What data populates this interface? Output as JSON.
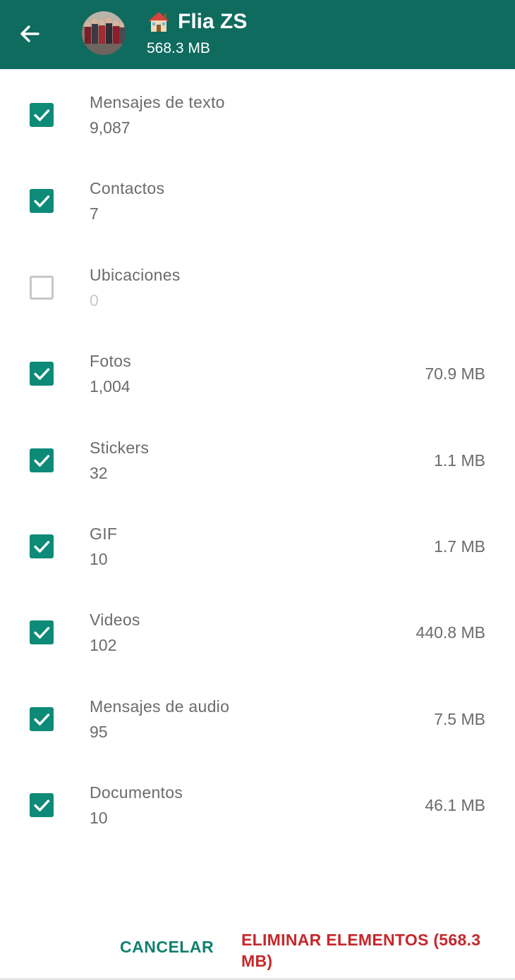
{
  "header": {
    "title": "Flia ZS",
    "size": "568.3 MB",
    "back_icon": "arrow-back-icon",
    "title_icon": "house-icon"
  },
  "colors": {
    "header_bg": "#0e6b5e",
    "checkbox_on": "#0e8a78",
    "cancel": "#11806f",
    "delete": "#c4282b"
  },
  "items": [
    {
      "label": "Mensajes de texto",
      "count": "9,087",
      "size": "",
      "checked": true
    },
    {
      "label": "Contactos",
      "count": "7",
      "size": "",
      "checked": true
    },
    {
      "label": "Ubicaciones",
      "count": "0",
      "size": "",
      "checked": false
    },
    {
      "label": "Fotos",
      "count": "1,004",
      "size": "70.9 MB",
      "checked": true
    },
    {
      "label": "Stickers",
      "count": "32",
      "size": "1.1 MB",
      "checked": true
    },
    {
      "label": "GIF",
      "count": "10",
      "size": "1.7 MB",
      "checked": true
    },
    {
      "label": "Videos",
      "count": "102",
      "size": "440.8 MB",
      "checked": true
    },
    {
      "label": "Mensajes de audio",
      "count": "95",
      "size": "7.5 MB",
      "checked": true
    },
    {
      "label": "Documentos",
      "count": "10",
      "size": "46.1 MB",
      "checked": true
    }
  ],
  "footer": {
    "cancel_label": "CANCELAR",
    "delete_label": "ELIMINAR ELEMENTOS (568.3 MB)"
  }
}
